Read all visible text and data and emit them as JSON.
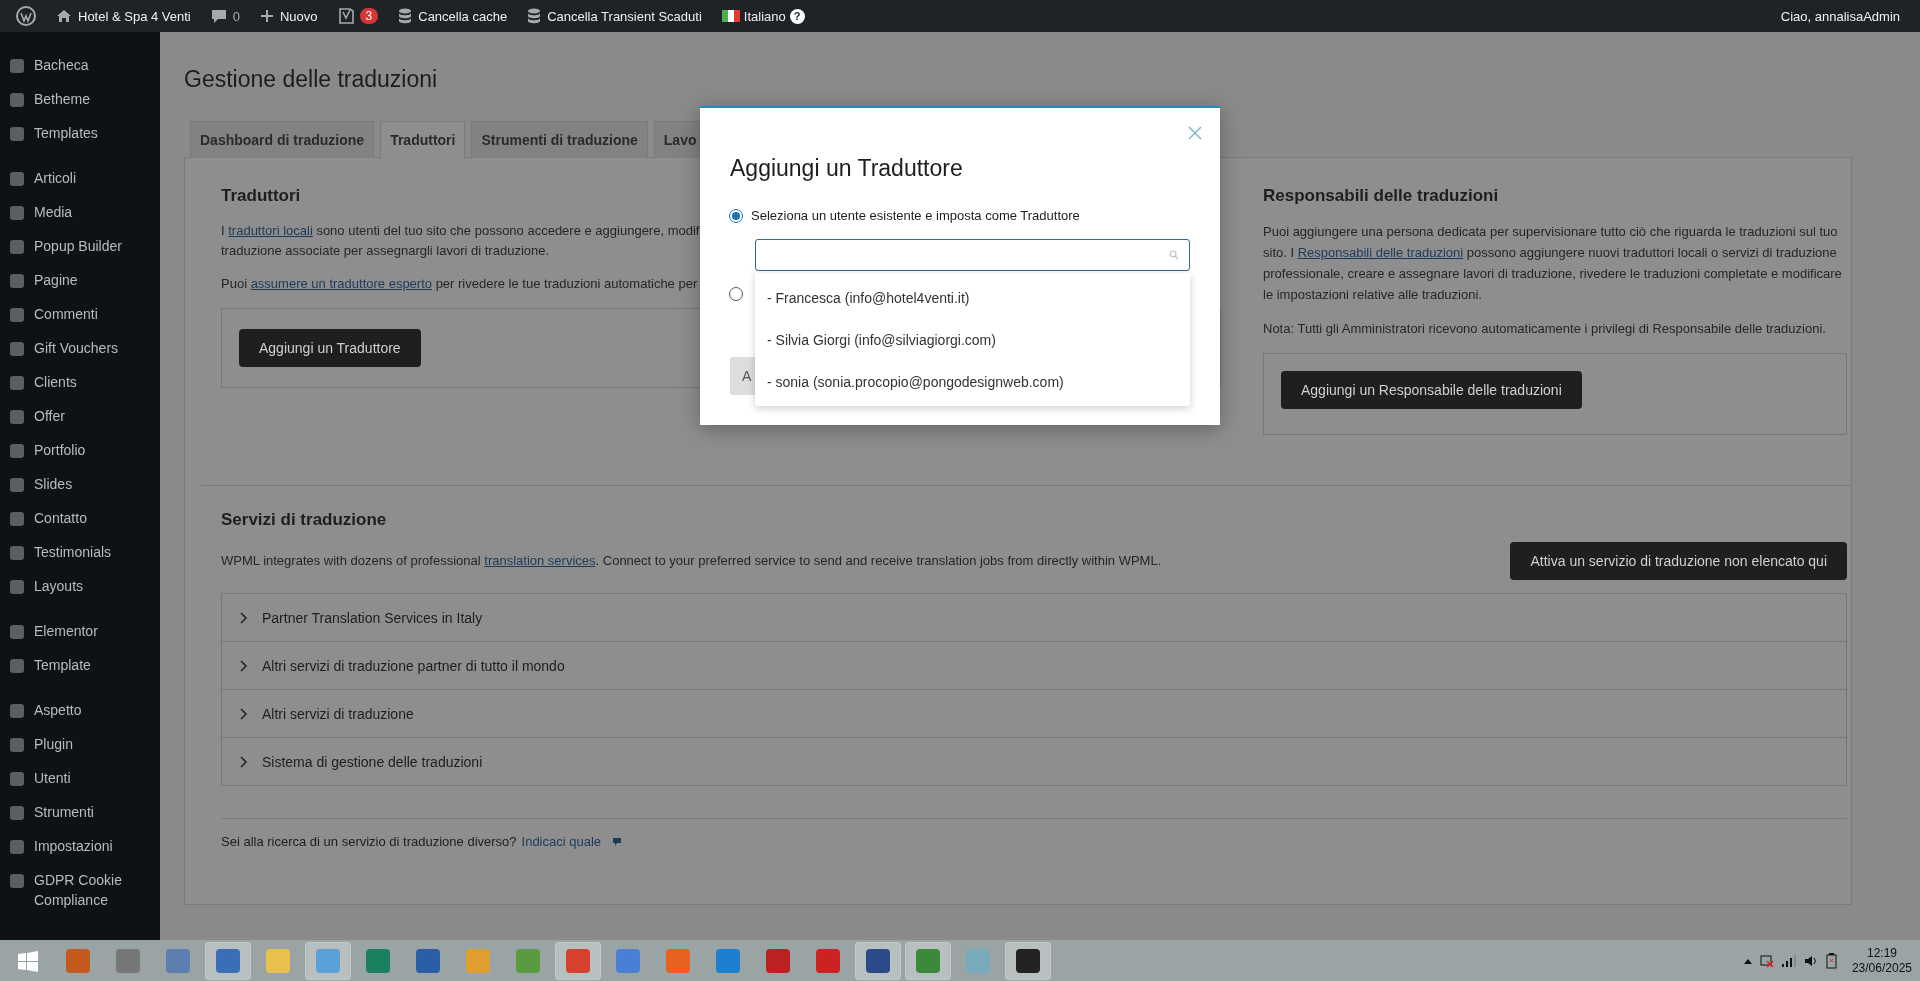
{
  "admin_bar": {
    "site": "Hotel & Spa 4 Venti",
    "comments": "0",
    "new": "Nuovo",
    "seo_badge": "3",
    "actions": [
      "Cancella cache",
      "Cancella Transient Scaduti"
    ],
    "language": "Italiano",
    "help": "?",
    "greeting": "Ciao, annalisaAdmin"
  },
  "sidebar": {
    "groups": [
      [
        "Bacheca",
        "Betheme",
        "Templates"
      ],
      [
        "Articoli",
        "Media",
        "Popup Builder",
        "Pagine",
        "Commenti",
        "Gift Vouchers",
        "Clients",
        "Offer",
        "Portfolio",
        "Slides",
        "Contatto",
        "Testimonials",
        "Layouts"
      ],
      [
        "Elementor",
        "Template"
      ],
      [
        "Aspetto",
        "Plugin",
        "Utenti",
        "Strumenti",
        "Impostazioni",
        "GDPR Cookie Compliance"
      ]
    ]
  },
  "page": {
    "title": "Gestione delle traduzioni",
    "tabs": [
      {
        "label": "Dashboard di traduzione",
        "selected": false
      },
      {
        "label": "Traduttori",
        "selected": true
      },
      {
        "label": "Strumenti di traduzione",
        "selected": false
      },
      {
        "label": "Lavo",
        "selected": false
      }
    ],
    "translators": {
      "heading": "Traduttori",
      "lines": [
        [
          {
            "text": "I "
          },
          {
            "text": "traduttori locali",
            "link": true
          },
          {
            "text": " sono utenti del tuo sito che possono accedere e aggiungere, modif"
          }
        ],
        [
          {
            "text": "traduzione associate per assegnargli lavori di traduzione."
          }
        ],
        [
          {
            "text": "Puoi "
          },
          {
            "text": "assumere un traduttore esperto",
            "link": true
          },
          {
            "text": " per rivedere le tue traduzioni automatiche per"
          }
        ]
      ],
      "button": "Aggiungi un Traduttore"
    },
    "managers": {
      "heading": "Responsabili delle traduzioni",
      "paragraph": [
        {
          "text": "Puoi aggiungere una persona dedicata per supervisionare tutto ciò che riguarda le traduzioni sul tuo sito. I "
        },
        {
          "text": "Responsabili delle traduzioni",
          "link": true
        },
        {
          "text": " possono aggiungere nuovi traduttori locali o servizi di traduzione professionale, creare e assegnare lavori di traduzione, rivedere le traduzioni completate e modificare le impostazioni relative alle traduzioni."
        }
      ],
      "note": "Nota: Tutti gli Amministratori ricevono automaticamente i privilegi di Responsabile delle traduzioni.",
      "button": "Aggiungi un Responsabile delle traduzioni"
    },
    "services": {
      "heading": "Servizi di traduzione",
      "intro": [
        {
          "text": "WPML integrates with dozens of professional "
        },
        {
          "text": "translation services",
          "link": true
        },
        {
          "text": ". Connect to your preferred service to send and receive translation jobs from directly within WPML."
        }
      ],
      "button": "Attiva un servizio di traduzione non elencato qui",
      "accordion": [
        {
          "label": "Partner Translation Services in Italy",
          "expanded": false
        },
        {
          "label": "Altri servizi di traduzione partner di tutto il mondo",
          "expanded": false
        },
        {
          "label": "Altri servizi di traduzione",
          "expanded": false
        },
        {
          "label": "Sistema di gestione delle traduzioni",
          "expanded": false
        }
      ],
      "footer": "Sei alla ricerca di un servizio di traduzione diverso?",
      "footer_link": "Indicaci quale"
    }
  },
  "dialog": {
    "title": "Aggiungi un Traduttore",
    "options": [
      {
        "label": "Seleziona un utente esistente e imposta come Traduttore",
        "selected": true
      },
      {
        "selected": false
      }
    ],
    "suggestions": [
      "- Francesca (info@hotel4venti.it)",
      "- Silvia Giorgi (info@silviagiorgi.com)",
      "- sonia (sonia.procopio@pongodesignweb.com)"
    ],
    "button": "A"
  },
  "taskbar": {
    "time": "12:19",
    "date": "23/06/2025"
  }
}
